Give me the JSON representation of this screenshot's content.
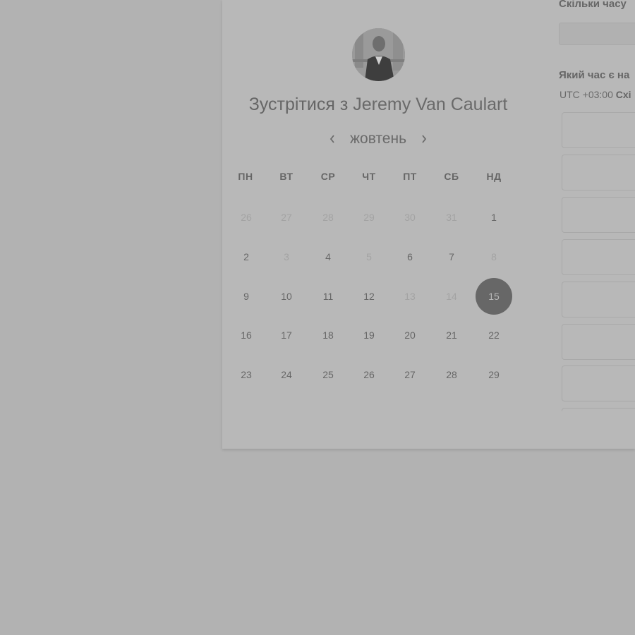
{
  "header": {
    "title_prefix": "Зустрітися з",
    "title_name": "Jeremy Van Caulart"
  },
  "calendar": {
    "month": "жовтень",
    "prev_icon": "chevron-left-icon",
    "next_icon": "chevron-right-icon",
    "weekdays": [
      "ПН",
      "ВТ",
      "СР",
      "ЧТ",
      "ПТ",
      "СБ",
      "НД"
    ],
    "weeks": [
      [
        {
          "d": "26",
          "m": true
        },
        {
          "d": "27",
          "m": true
        },
        {
          "d": "28",
          "m": true
        },
        {
          "d": "29",
          "m": true
        },
        {
          "d": "30",
          "m": true
        },
        {
          "d": "31",
          "m": true
        },
        {
          "d": "1",
          "m": false
        }
      ],
      [
        {
          "d": "2",
          "m": false
        },
        {
          "d": "3",
          "m": true
        },
        {
          "d": "4",
          "m": false
        },
        {
          "d": "5",
          "m": true
        },
        {
          "d": "6",
          "m": false
        },
        {
          "d": "7",
          "m": false
        },
        {
          "d": "8",
          "m": true
        }
      ],
      [
        {
          "d": "9",
          "m": false
        },
        {
          "d": "10",
          "m": false
        },
        {
          "d": "11",
          "m": false
        },
        {
          "d": "12",
          "m": false
        },
        {
          "d": "13",
          "m": true
        },
        {
          "d": "14",
          "m": true
        },
        {
          "d": "15",
          "m": false,
          "selected": true
        }
      ],
      [
        {
          "d": "16",
          "m": false
        },
        {
          "d": "17",
          "m": false
        },
        {
          "d": "18",
          "m": false
        },
        {
          "d": "19",
          "m": false
        },
        {
          "d": "20",
          "m": false
        },
        {
          "d": "21",
          "m": false
        },
        {
          "d": "22",
          "m": false
        }
      ],
      [
        {
          "d": "23",
          "m": false
        },
        {
          "d": "24",
          "m": false
        },
        {
          "d": "25",
          "m": false
        },
        {
          "d": "26",
          "m": false
        },
        {
          "d": "27",
          "m": false
        },
        {
          "d": "28",
          "m": false
        },
        {
          "d": "29",
          "m": false
        }
      ]
    ],
    "selected_day": "15"
  },
  "booking": {
    "duration_label": "Скільки часу",
    "timezone_label": "Який час є на",
    "timezone_offset": "UTC +03:00",
    "timezone_name": "Схі"
  },
  "colors": {
    "backdrop": "#b2b2b2",
    "card": "#b8b8b8",
    "selected_day": "#676767"
  }
}
